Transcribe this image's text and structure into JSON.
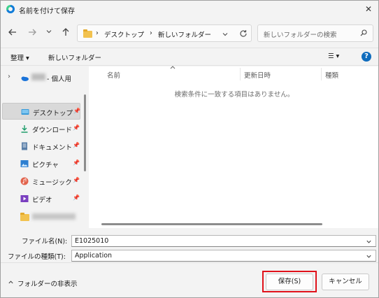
{
  "window": {
    "title": "名前を付けて保存",
    "close_glyph": "✕"
  },
  "address": {
    "chevron": "›",
    "crumbs": [
      "デスクトップ",
      "新しいフォルダー"
    ]
  },
  "search": {
    "placeholder": "新しいフォルダーの検索"
  },
  "commands": {
    "organize": "整理 ▾",
    "new_folder": "新しいフォルダー",
    "view_glyph": "☰ ▾",
    "help": "?"
  },
  "nav": {
    "items": [
      {
        "label": "- 個人用",
        "icon": "onedrive-icon",
        "pinned": false
      },
      {
        "label": "デスクトップ",
        "icon": "desktop-icon",
        "pinned": true
      },
      {
        "label": "ダウンロード",
        "icon": "download-icon",
        "pinned": true
      },
      {
        "label": "ドキュメント",
        "icon": "document-icon",
        "pinned": true
      },
      {
        "label": "ピクチャ",
        "icon": "pictures-icon",
        "pinned": true
      },
      {
        "label": "ミュージック",
        "icon": "music-icon",
        "pinned": true
      },
      {
        "label": "ビデオ",
        "icon": "video-icon",
        "pinned": true
      }
    ]
  },
  "filelist": {
    "columns": [
      "名前",
      "更新日時",
      "種類"
    ],
    "empty_message": "検索条件に一致する項目はありません。"
  },
  "form": {
    "filename_label": "ファイル名(N):",
    "filename_value": "E1025010",
    "filetype_label": "ファイルの種類(T):",
    "filetype_value": "Application"
  },
  "footer": {
    "hide_folders": "フォルダーの非表示",
    "save": "保存(S)",
    "cancel": "キャンセル"
  },
  "colors": {
    "accent": "#0f6cbd",
    "highlight": "#e0121b"
  }
}
